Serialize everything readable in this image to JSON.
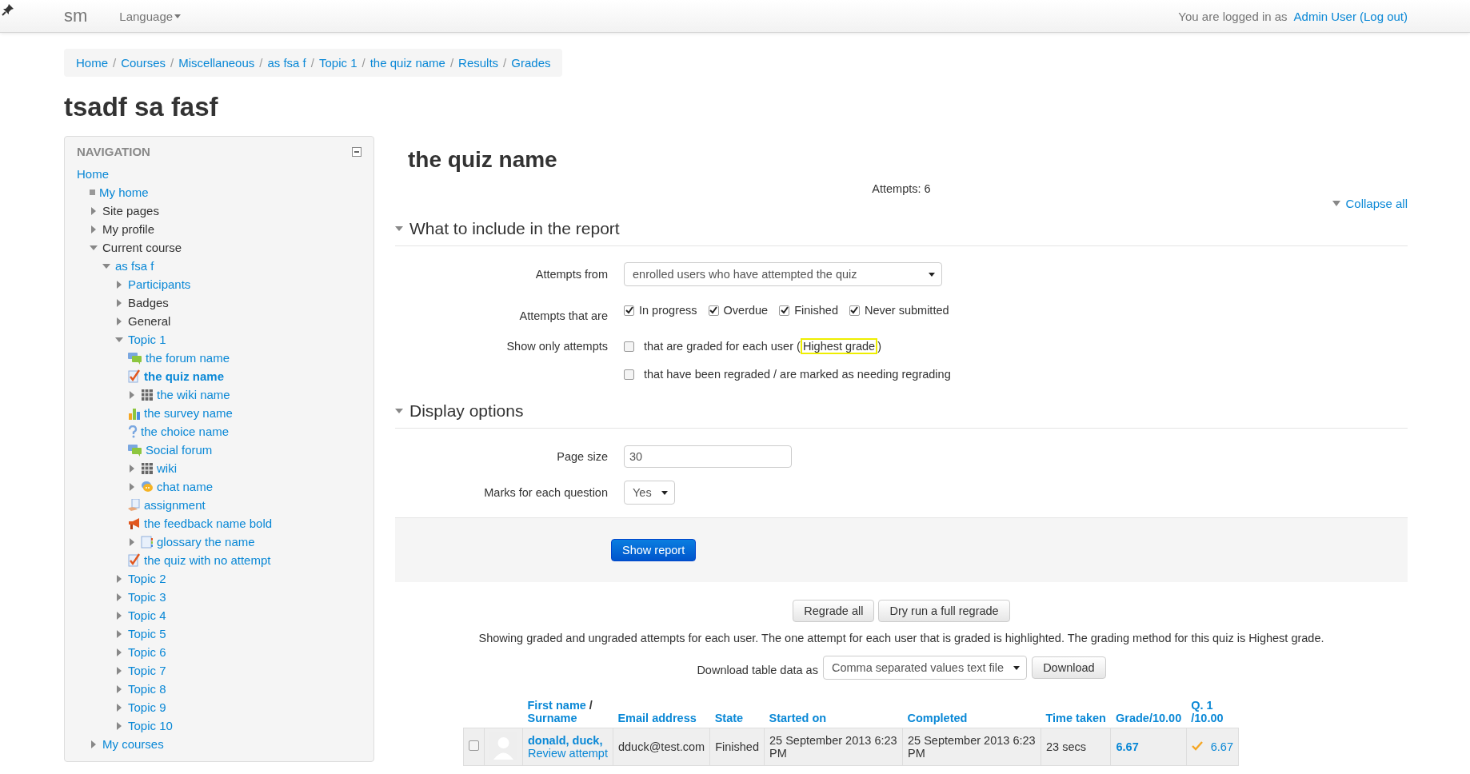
{
  "topbar": {
    "brand": "sm",
    "language_menu": "Language",
    "login_text": "You are logged in as",
    "user_link": "Admin User",
    "logout_link": "(Log out)"
  },
  "breadcrumb": [
    {
      "label": "Home"
    },
    {
      "separator": "/",
      "label": "Courses"
    },
    {
      "separator": "/",
      "label": "Miscellaneous"
    },
    {
      "separator": "/",
      "label": "as fsa f"
    },
    {
      "separator": "/",
      "label": "Topic 1"
    },
    {
      "separator": "/",
      "label": "the quiz name"
    },
    {
      "separator": "/",
      "label": "Results"
    },
    {
      "separator": "/",
      "label": "Grades"
    }
  ],
  "page_title": "tsadf sa fasf",
  "navigation": {
    "title": "NAVIGATION",
    "items": [
      {
        "label": "Home",
        "linked": true,
        "current": false,
        "children": [
          {
            "label": "My home",
            "kind": "bullet",
            "linked": true,
            "current": false
          },
          {
            "label": "Site pages",
            "linked": false,
            "current": false,
            "expanded": false
          },
          {
            "label": "My profile",
            "linked": false,
            "current": false,
            "expanded": false
          },
          {
            "label": "Current course",
            "linked": false,
            "current": false,
            "expanded": true,
            "children": [
              {
                "label": "as fsa f",
                "linked": true,
                "current": false,
                "expanded": true,
                "children": [
                  {
                    "label": "Participants",
                    "linked": true,
                    "current": false,
                    "expanded": false
                  },
                  {
                    "label": "Badges",
                    "linked": false,
                    "current": false,
                    "expanded": false
                  },
                  {
                    "label": "General",
                    "linked": false,
                    "current": false,
                    "expanded": false
                  },
                  {
                    "label": "Topic 1",
                    "linked": true,
                    "current": false,
                    "expanded": true,
                    "children": [
                      {
                        "label": "the forum name",
                        "kind": "forum",
                        "linked": true,
                        "current": false
                      },
                      {
                        "label": "the quiz name",
                        "kind": "quiz",
                        "linked": true,
                        "current": true
                      },
                      {
                        "label": "the wiki name",
                        "kind": "wiki",
                        "linked": true,
                        "current": false,
                        "expanded": false
                      },
                      {
                        "label": "the survey name",
                        "kind": "survey",
                        "linked": true,
                        "current": false
                      },
                      {
                        "label": "the choice name",
                        "kind": "choice",
                        "linked": true,
                        "current": false
                      },
                      {
                        "label": "Social forum",
                        "kind": "forum",
                        "linked": true,
                        "current": false
                      },
                      {
                        "label": "wiki",
                        "kind": "wiki",
                        "linked": true,
                        "current": false,
                        "expanded": false
                      },
                      {
                        "label": "chat name",
                        "kind": "chat",
                        "linked": true,
                        "current": false,
                        "expanded": false
                      },
                      {
                        "label": "assignment",
                        "kind": "assignment",
                        "linked": true,
                        "current": false
                      },
                      {
                        "label": "the feedback name bold",
                        "kind": "feedback",
                        "linked": true,
                        "current": false
                      },
                      {
                        "label": "glossary the name",
                        "kind": "glossary",
                        "linked": true,
                        "current": false,
                        "expanded": false
                      },
                      {
                        "label": "the quiz with no attempt",
                        "kind": "quiz",
                        "linked": true,
                        "current": false
                      }
                    ]
                  },
                  {
                    "label": "Topic 2",
                    "linked": true,
                    "current": false,
                    "expanded": false
                  },
                  {
                    "label": "Topic 3",
                    "linked": true,
                    "current": false,
                    "expanded": false
                  },
                  {
                    "label": "Topic 4",
                    "linked": true,
                    "current": false,
                    "expanded": false
                  },
                  {
                    "label": "Topic 5",
                    "linked": true,
                    "current": false,
                    "expanded": false
                  },
                  {
                    "label": "Topic 6",
                    "linked": true,
                    "current": false,
                    "expanded": false
                  },
                  {
                    "label": "Topic 7",
                    "linked": true,
                    "current": false,
                    "expanded": false
                  },
                  {
                    "label": "Topic 8",
                    "linked": true,
                    "current": false,
                    "expanded": false
                  },
                  {
                    "label": "Topic 9",
                    "linked": true,
                    "current": false,
                    "expanded": false
                  },
                  {
                    "label": "Topic 10",
                    "linked": true,
                    "current": false,
                    "expanded": false
                  }
                ]
              }
            ]
          },
          {
            "label": "My courses",
            "linked": true,
            "current": false,
            "expanded": false
          }
        ]
      }
    ]
  },
  "report": {
    "title": "the quiz name",
    "attempts": "Attempts: 6",
    "collapse_all": "Collapse all",
    "include_section": {
      "title": "What to include in the report",
      "expanded": true,
      "attempts_from": {
        "label": "Attempts from",
        "value": "enrolled users who have attempted the quiz"
      },
      "attempts_that_are": {
        "label": "Attempts that are",
        "options": [
          {
            "label": "In progress",
            "checked": true
          },
          {
            "label": "Overdue",
            "checked": true
          },
          {
            "label": "Finished",
            "checked": true
          },
          {
            "label": "Never submitted",
            "checked": true
          }
        ]
      },
      "show_only": {
        "label": "Show only attempts",
        "options": [
          {
            "label": "that are graded for each user (",
            "highlight": "Highest grade",
            "suffix": ")",
            "checked": false
          },
          {
            "label": "that have been regraded / are marked as needing regrading",
            "checked": false
          }
        ]
      }
    },
    "display_section": {
      "title": "Display options",
      "expanded": true,
      "page_size": {
        "label": "Page size",
        "value": "30"
      },
      "marks": {
        "label": "Marks for each question",
        "value": "Yes"
      }
    },
    "show_report": "Show report",
    "regrade_buttons": [
      "Regrade all",
      "Dry run a full regrade"
    ],
    "summary": "Showing graded and ungraded attempts for each user. The one attempt for each user that is graded is highlighted. The grading method for this quiz is Highest grade.",
    "download": {
      "label": "Download table data as",
      "format": "Comma separated values text file",
      "button": "Download"
    },
    "table": {
      "columns": [
        {
          "label": "First name",
          "separator": "/",
          "label_2": "Surname"
        },
        {
          "label": "Email address"
        },
        {
          "label": "State"
        },
        {
          "label": "Started on"
        },
        {
          "label": "Completed"
        },
        {
          "label": "Time taken"
        },
        {
          "label": "Grade/10.00"
        },
        {
          "label": "Q. 1",
          "label_2": "/10.00"
        }
      ],
      "rows": [
        {
          "checked": false,
          "highlighted": true,
          "name": "donald, duck,",
          "review": "Review attempt",
          "email": "dduck@test.com",
          "state": "Finished",
          "started": "25 September 2013 6:23 PM",
          "completed": "25 September 2013 6:23 PM",
          "time_taken": "23 secs",
          "grade": "6.67",
          "q1": {
            "kind": "partial",
            "value": "6.67"
          }
        }
      ]
    }
  }
}
